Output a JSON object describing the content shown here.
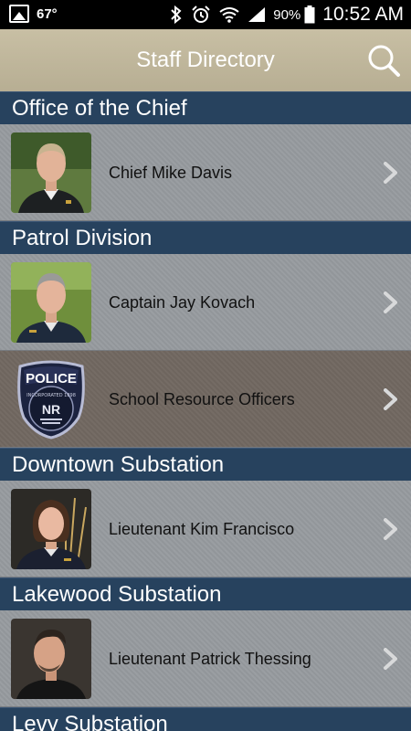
{
  "status_bar": {
    "temperature": "67°",
    "battery": "90%",
    "time": "10:52 AM",
    "icons": [
      "gallery-icon",
      "bluetooth-icon",
      "alarm-icon",
      "wifi-icon",
      "signal-icon",
      "battery-icon"
    ]
  },
  "app_bar": {
    "title": "Staff Directory",
    "search_icon": "search-icon",
    "background": "#b9b094"
  },
  "sections": [
    {
      "title": "Office of the Chief",
      "items": [
        {
          "label": "Chief Mike Davis",
          "avatar": "portrait-photo"
        }
      ]
    },
    {
      "title": "Patrol Division",
      "items": [
        {
          "label": "Captain Jay Kovach",
          "avatar": "portrait-photo"
        },
        {
          "label": "School Resource Officers",
          "avatar": "police-badge-logo",
          "highlighted": true
        }
      ]
    },
    {
      "title": "Downtown Substation",
      "items": [
        {
          "label": "Lieutenant Kim Francisco",
          "avatar": "portrait-photo"
        }
      ]
    },
    {
      "title": "Lakewood Substation",
      "items": [
        {
          "label": "Lieutenant Patrick Thessing",
          "avatar": "portrait-photo"
        }
      ]
    },
    {
      "title": "Levy Substation",
      "items": []
    }
  ],
  "badge_logo": {
    "top_text": "POLICE",
    "ring_text": "INCORPORATED 1898",
    "monogram": "NR"
  },
  "colors": {
    "section_header": "#27425e",
    "row": "#95999d",
    "row_highlight": "#716861"
  }
}
